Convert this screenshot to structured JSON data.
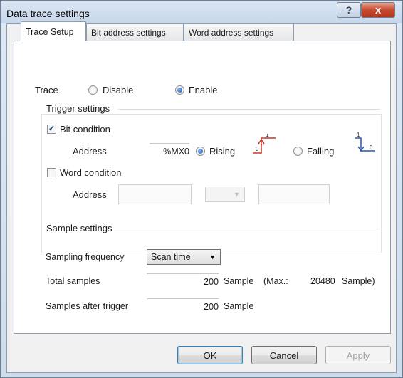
{
  "window": {
    "title": "Data trace settings"
  },
  "titlebar": {
    "help": "?",
    "close": "x"
  },
  "tabs": [
    {
      "label": "Trace Setup",
      "active": true
    },
    {
      "label": "Bit address settings",
      "active": false
    },
    {
      "label": "Word address settings",
      "active": false
    }
  ],
  "trace": {
    "label": "Trace",
    "disable": "Disable",
    "enable": "Enable",
    "selected": "Enable"
  },
  "trigger": {
    "title": "Trigger settings",
    "bit_condition": {
      "label": "Bit condition",
      "checked": true,
      "address_label": "Address",
      "address_value": "%MX0",
      "rising": "Rising",
      "falling": "Falling",
      "selected": "Rising"
    },
    "word_condition": {
      "label": "Word condition",
      "checked": false,
      "address_label": "Address"
    },
    "glyph_rising_top": "1",
    "glyph_rising_bottom": "0",
    "glyph_falling_top": "1",
    "glyph_falling_bottom": "0"
  },
  "sample": {
    "title": "Sample settings",
    "frequency_label": "Sampling frequency",
    "frequency_value": "Scan time",
    "total_label": "Total samples",
    "total_value": "200",
    "total_unit": "Sample",
    "max_label": "(Max.:",
    "max_value": "20480",
    "max_unit": "Sample)",
    "after_label": "Samples after trigger",
    "after_value": "200",
    "after_unit": "Sample"
  },
  "buttons": {
    "ok": "OK",
    "cancel": "Cancel",
    "apply": "Apply"
  },
  "colors": {
    "accent": "#1d57b8",
    "close": "#c44a2e"
  }
}
